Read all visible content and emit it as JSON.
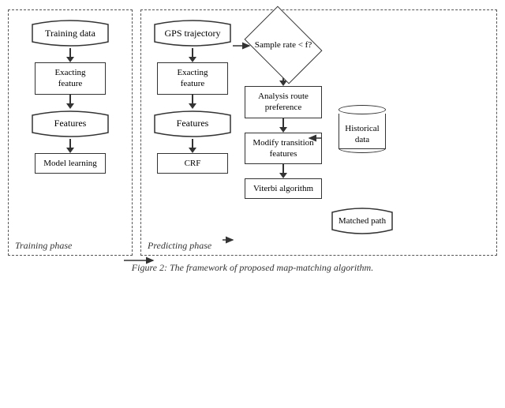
{
  "caption": "Figure 2: The framework of proposed map-matching algorithm.",
  "phases": {
    "training_label": "Training phase",
    "predicting_label": "Predicting phase"
  },
  "training_flow": [
    {
      "id": "training-data",
      "label": "Training data",
      "shape": "ribbon"
    },
    {
      "id": "exacting-feature-1",
      "label": "Exacting feature",
      "shape": "rect"
    },
    {
      "id": "features-1",
      "label": "Features",
      "shape": "ribbon"
    },
    {
      "id": "model-learning",
      "label": "Model learning",
      "shape": "rect"
    }
  ],
  "predicting_col1": [
    {
      "id": "gps-trajectory",
      "label": "GPS trajectory",
      "shape": "ribbon"
    },
    {
      "id": "exacting-feature-2",
      "label": "Exacting feature",
      "shape": "rect"
    },
    {
      "id": "features-2",
      "label": "Features",
      "shape": "ribbon"
    },
    {
      "id": "crf",
      "label": "CRF",
      "shape": "rect"
    }
  ],
  "predicting_col2": [
    {
      "id": "sample-rate",
      "label": "Sample rate < f?",
      "shape": "diamond"
    },
    {
      "id": "analysis-route",
      "label": "Analysis route preference",
      "shape": "rect"
    },
    {
      "id": "modify-transition",
      "label": "Modify transition features",
      "shape": "rect"
    },
    {
      "id": "viterbi",
      "label": "Viterbi algorithm",
      "shape": "rect"
    }
  ],
  "side_elements": [
    {
      "id": "historical-data",
      "label": "Historical data",
      "shape": "cylinder"
    },
    {
      "id": "matched-path",
      "label": "Matched path",
      "shape": "ribbon"
    }
  ]
}
